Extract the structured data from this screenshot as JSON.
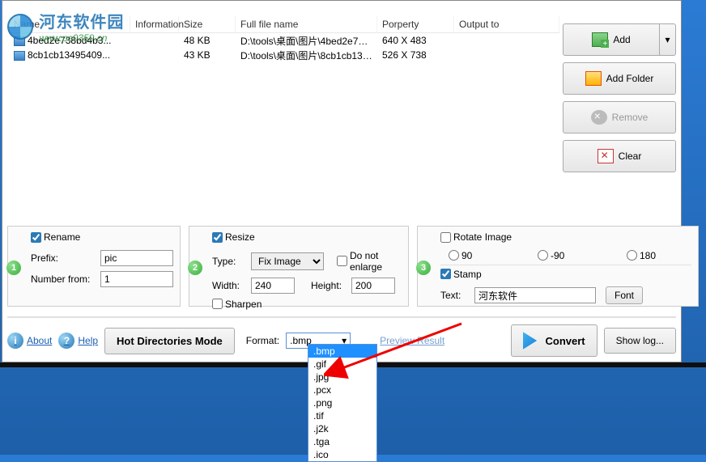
{
  "watermark": {
    "title": "河东软件园",
    "url": "www.pc0359.cn"
  },
  "columns": {
    "name": "Name",
    "info": "Information",
    "size": "Size",
    "full": "Full file name",
    "prop": "Porperty",
    "out": "Output to"
  },
  "files": [
    {
      "name": "4bed2e738bd4b3...",
      "info": "",
      "size": "48 KB",
      "full": "D:\\tools\\桌面\\图片\\4bed2e738...",
      "prop": "640 X 483",
      "out": ""
    },
    {
      "name": "8cb1cb13495409...",
      "info": "",
      "size": "43 KB",
      "full": "D:\\tools\\桌面\\图片\\8cb1cb1349...",
      "prop": "526 X 738",
      "out": ""
    }
  ],
  "buttons": {
    "add": "Add",
    "add_folder": "Add Folder",
    "remove": "Remove",
    "clear": "Clear",
    "about": "About",
    "help": "Help",
    "hot_dir": "Hot Directories Mode",
    "convert": "Convert",
    "show_log": "Show log...",
    "preview": "Preview Result",
    "font": "Font"
  },
  "rename": {
    "checkbox": "Rename",
    "prefix_label": "Prefix:",
    "prefix_value": "pic",
    "number_label": "Number from:",
    "number_value": "1"
  },
  "resize": {
    "checkbox": "Resize",
    "type_label": "Type:",
    "type_value": "Fix Image",
    "no_enlarge": "Do not enlarge",
    "width_label": "Width:",
    "width_value": "240",
    "height_label": "Height:",
    "height_value": "200",
    "sharpen": "Sharpen"
  },
  "rotate": {
    "checkbox": "Rotate Image",
    "r90": "90",
    "rn90": "-90",
    "r180": "180"
  },
  "stamp": {
    "checkbox": "Stamp",
    "text_label": "Text:",
    "text_value": "河东软件"
  },
  "format": {
    "label": "Format:",
    "selected": ".bmp",
    "options": [
      ".bmp",
      ".gif",
      ".jpg",
      ".pcx",
      ".png",
      ".tif",
      ".j2k",
      ".tga",
      ".ico"
    ]
  },
  "steps": {
    "s1": "1",
    "s2": "2",
    "s3": "3"
  }
}
